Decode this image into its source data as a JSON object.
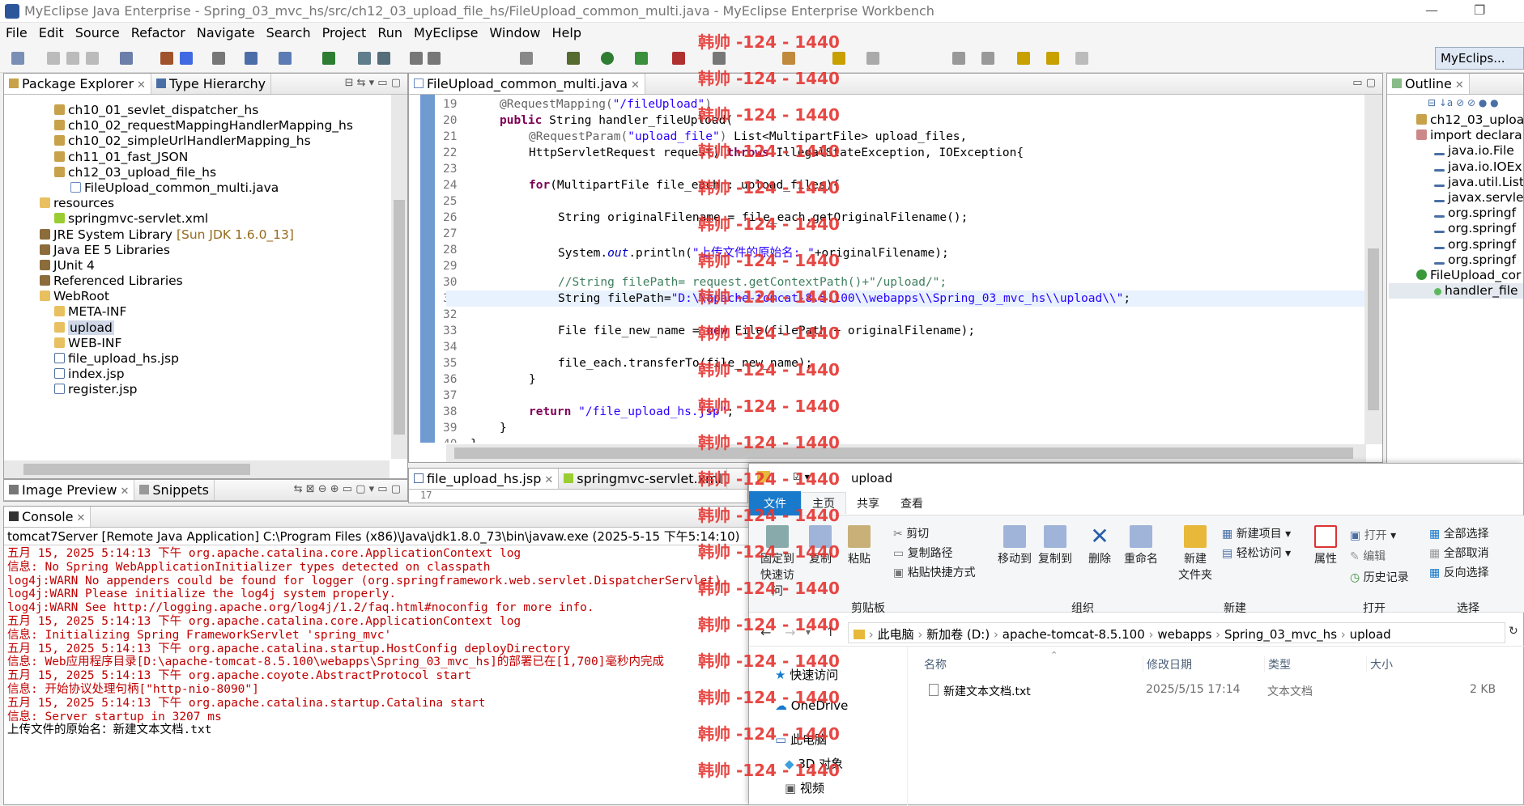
{
  "window": {
    "title": "MyEclipse Java Enterprise - Spring_03_mvc_hs/src/ch12_03_upload_file_hs/FileUpload_common_multi.java - MyEclipse Enterprise Workbench"
  },
  "menu": [
    "File",
    "Edit",
    "Source",
    "Refactor",
    "Navigate",
    "Search",
    "Project",
    "Run",
    "MyEclipse",
    "Window",
    "Help"
  ],
  "perspective": "MyEclips...",
  "package_explorer": {
    "tabs": [
      "Package Explorer",
      "Type Hierarchy"
    ],
    "items": [
      {
        "label": "ch10_01_sevlet_dispatcher_hs",
        "icon": "package-icon",
        "level": 3
      },
      {
        "label": "ch10_02_requestMappingHandlerMapping_hs",
        "icon": "package-icon",
        "level": 3
      },
      {
        "label": "ch10_02_simpleUrlHandlerMapping_hs",
        "icon": "package-icon",
        "level": 3
      },
      {
        "label": "ch11_01_fast_JSON",
        "icon": "package-icon",
        "level": 3
      },
      {
        "label": "ch12_03_upload_file_hs",
        "icon": "package-icon",
        "level": 3
      },
      {
        "label": "FileUpload_common_multi.java",
        "icon": "java-file-icon",
        "level": 4
      },
      {
        "label": "resources",
        "icon": "source-folder-icon",
        "level": 2
      },
      {
        "label": "springmvc-servlet.xml",
        "icon": "xml-file-icon",
        "level": 3
      },
      {
        "label": "JRE System Library",
        "suffix": "[Sun JDK 1.6.0_13]",
        "icon": "library-icon",
        "level": 2
      },
      {
        "label": "Java EE 5 Libraries",
        "icon": "library-icon",
        "level": 2
      },
      {
        "label": "JUnit 4",
        "icon": "library-icon",
        "level": 2
      },
      {
        "label": "Referenced Libraries",
        "icon": "library-icon",
        "level": 2
      },
      {
        "label": "WebRoot",
        "icon": "folder-icon",
        "level": 2
      },
      {
        "label": "META-INF",
        "icon": "folder-icon",
        "level": 3
      },
      {
        "label": "upload",
        "icon": "folder-icon",
        "level": 3,
        "selected": true
      },
      {
        "label": "WEB-INF",
        "icon": "folder-icon",
        "level": 3
      },
      {
        "label": "file_upload_hs.jsp",
        "icon": "jsp-file-icon",
        "level": 3
      },
      {
        "label": "index.jsp",
        "icon": "jsp-file-icon",
        "level": 3
      },
      {
        "label": "register.jsp",
        "icon": "jsp-file-icon",
        "level": 3
      }
    ]
  },
  "editor": {
    "tab": "FileUpload_common_multi.java",
    "line_numbers": [
      "19",
      "20",
      "21",
      "22",
      "23",
      "24",
      "25",
      "26",
      "27",
      "28",
      "29",
      "30",
      "31",
      "32",
      "33",
      "34",
      "35",
      "36",
      "37",
      "38",
      "39",
      "40"
    ],
    "highlight_line": "31"
  },
  "editor2": {
    "tabs": [
      "file_upload_hs.jsp",
      "springmvc-servlet.xml"
    ],
    "line": "17"
  },
  "outline": {
    "tab": "Outline",
    "items": [
      "ch12_03_uploa",
      "import declara",
      "java.io.File",
      "java.io.IOEx",
      "java.util.List",
      "javax.servle",
      "org.springf",
      "org.springf",
      "org.springf",
      "org.springf",
      "FileUpload_cor",
      "handler_file"
    ]
  },
  "image_preview": {
    "tabs": [
      "Image Preview",
      "Snippets"
    ]
  },
  "console": {
    "tab": "Console",
    "header": "tomcat7Server [Remote Java Application] C:\\Program Files (x86)\\Java\\jdk1.8.0_73\\bin\\javaw.exe (2025-5-15 下午5:14:10)",
    "lines": [
      "五月 15, 2025 5:14:13 下午 org.apache.catalina.core.ApplicationContext log",
      "信息: No Spring WebApplicationInitializer types detected on classpath",
      "log4j:WARN No appenders could be found for logger (org.springframework.web.servlet.DispatcherServlet).",
      "log4j:WARN Please initialize the log4j system properly.",
      "log4j:WARN See http://logging.apache.org/log4j/1.2/faq.html#noconfig for more info.",
      "五月 15, 2025 5:14:13 下午 org.apache.catalina.core.ApplicationContext log",
      "信息: Initializing Spring FrameworkServlet 'spring_mvc'",
      "五月 15, 2025 5:14:13 下午 org.apache.catalina.startup.HostConfig deployDirectory",
      "信息: Web应用程序目录[D:\\apache-tomcat-8.5.100\\webapps\\Spring_03_mvc_hs]的部署已在[1,700]毫秒内完成",
      "五月 15, 2025 5:14:13 下午 org.apache.coyote.AbstractProtocol start",
      "信息: 开始协议处理句柄[\"http-nio-8090\"]",
      "五月 15, 2025 5:14:13 下午 org.apache.catalina.startup.Catalina start",
      "信息: Server startup in 3207 ms",
      "上传文件的原始名：新建文本文档.txt"
    ]
  },
  "explorer": {
    "title": "upload",
    "ribbon_tabs": [
      "文件",
      "主页",
      "共享",
      "查看"
    ],
    "clipboard": {
      "pin": "固定到\n快速访问",
      "copy": "复制",
      "paste": "粘贴",
      "cut": "剪切",
      "copy_path": "复制路径",
      "paste_shortcut": "粘贴快捷方式",
      "group": "剪贴板"
    },
    "organize": {
      "move": "移动到",
      "copyto": "复制到",
      "delete": "删除",
      "rename": "重命名",
      "group": "组织"
    },
    "new": {
      "folder": "新建\n文件夹",
      "new_item": "新建项目",
      "easy_access": "轻松访问",
      "group": "新建"
    },
    "open": {
      "props": "属性",
      "open": "打开",
      "edit": "编辑",
      "history": "历史记录",
      "group": "打开"
    },
    "select": {
      "all": "全部选择",
      "none": "全部取消",
      "invert": "反向选择",
      "group": "选择"
    },
    "breadcrumb": [
      "此电脑",
      "新加卷 (D:)",
      "apache-tomcat-8.5.100",
      "webapps",
      "Spring_03_mvc_hs",
      "upload"
    ],
    "nav": [
      "快速访问",
      "OneDrive",
      "此电脑",
      "3D 对象",
      "视频"
    ],
    "columns": [
      "名称",
      "修改日期",
      "类型",
      "大小"
    ],
    "files": [
      {
        "name": "新建文本文档.txt",
        "date": "2025/5/15 17:14",
        "type": "文本文档",
        "size": "2 KB"
      }
    ]
  },
  "watermark": "韩帅 -124 - 1440"
}
